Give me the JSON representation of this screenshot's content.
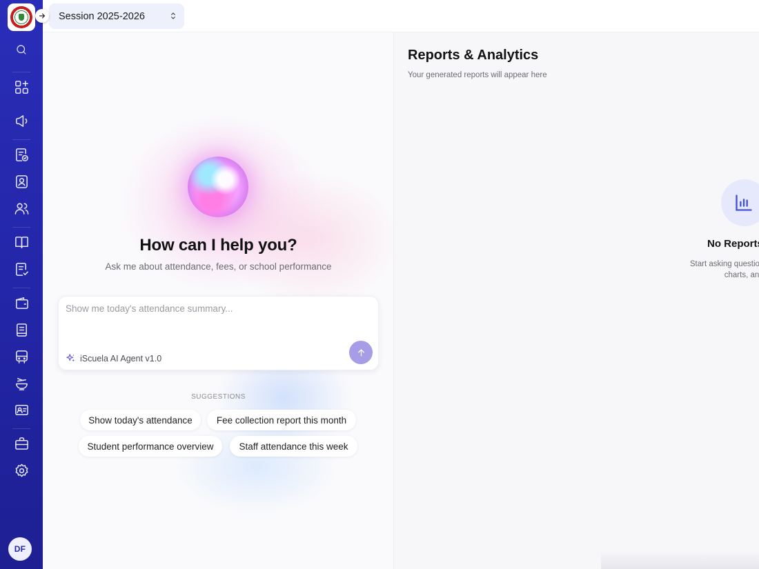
{
  "session": {
    "label": "Session 2025-2026"
  },
  "user": {
    "initials": "DF"
  },
  "sidebar_icons": [
    "search-icon",
    "apps-icon",
    "megaphone-icon",
    "clipboard-check-icon",
    "contact-icon",
    "users-icon",
    "book-open-icon",
    "checklist-icon",
    "wallet-icon",
    "notebook-icon",
    "bus-icon",
    "meal-icon",
    "id-card-icon",
    "briefcase-icon",
    "settings-icon"
  ],
  "chat": {
    "title": "How can I help you?",
    "subtitle": "Ask me about attendance, fees, or school performance",
    "input_placeholder": "Show me today's attendance summary...",
    "agent_label": "iScuela AI Agent v1.0",
    "suggestions_label": "SUGGESTIONS",
    "suggestions": [
      "Show today's attendance",
      "Fee collection report this month",
      "Student performance overview",
      "Staff attendance this week"
    ]
  },
  "reports": {
    "title": "Reports & Analytics",
    "subtitle": "Your generated reports will appear here",
    "empty_title": "No Reports",
    "empty_desc_line1": "Start asking questions in the chat to",
    "empty_desc_line2": "charts, and data"
  },
  "colors": {
    "sidebar": "#2326a8",
    "send_button": "#a79ce6",
    "accent": "#3f51d8"
  }
}
